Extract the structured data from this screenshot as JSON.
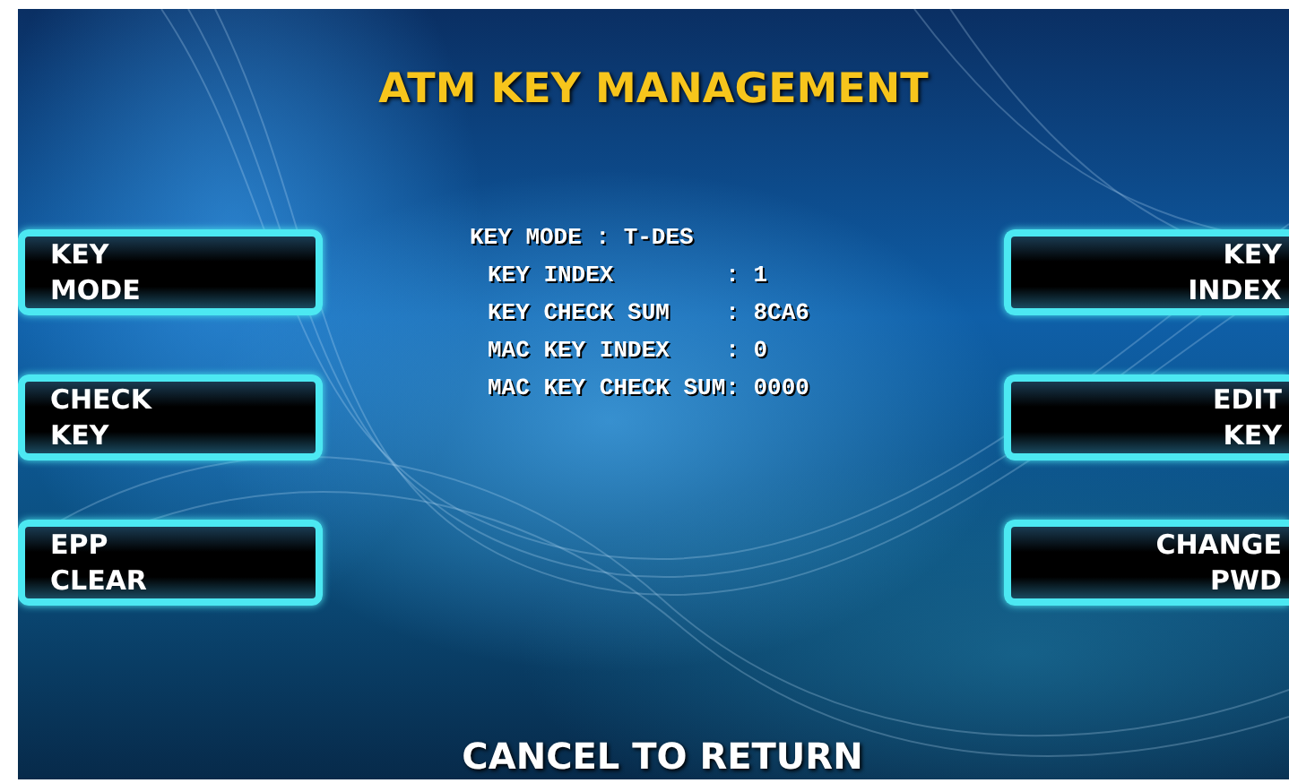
{
  "title": "ATM KEY MANAGEMENT",
  "left_buttons": [
    {
      "lines": [
        "KEY",
        "MODE"
      ]
    },
    {
      "lines": [
        "CHECK",
        "KEY"
      ]
    },
    {
      "lines": [
        "EPP",
        "CLEAR"
      ]
    }
  ],
  "info": [
    {
      "kind": "header",
      "text": "KEY MODE : T-DES"
    },
    {
      "kind": "field",
      "label": "KEY INDEX",
      "value": ": 1"
    },
    {
      "kind": "field",
      "label": "KEY CHECK SUM",
      "value": ": 8CA6"
    },
    {
      "kind": "field",
      "label": "MAC KEY INDEX",
      "value": ": 0"
    },
    {
      "kind": "field",
      "label": "MAC KEY CHECK SUM",
      "value": ": 0000"
    }
  ],
  "right_buttons": [
    {
      "lines": [
        "KEY",
        "INDEX"
      ]
    },
    {
      "lines": [
        "EDIT",
        "KEY"
      ]
    },
    {
      "lines": [
        "CHANGE",
        "PWD"
      ]
    }
  ],
  "footer": "CANCEL TO RETURN"
}
